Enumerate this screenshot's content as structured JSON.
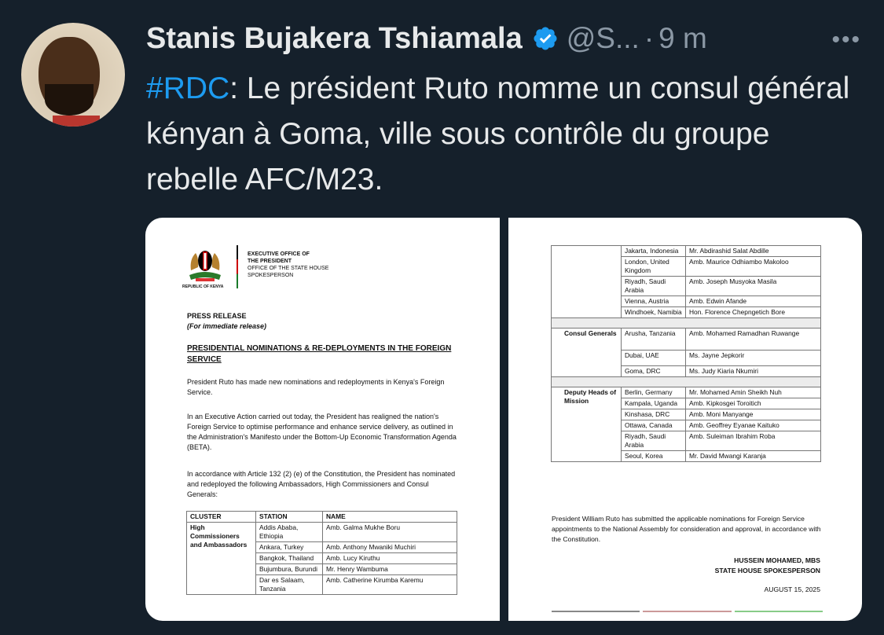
{
  "tweet": {
    "author_name": "Stanis Bujakera Tshiamala",
    "handle": "@S...",
    "separator": "·",
    "time": "9 m",
    "more_label": "•••",
    "hashtag": "#RDC",
    "text": ": Le président Ruto nomme un consul général kényan à Goma, ville sous contrôle du groupe rebelle AFC/M23."
  },
  "colors": {
    "background": "#15202b",
    "link": "#1d9bf0",
    "muted": "#8b98a5",
    "text": "#e7e9ea"
  },
  "icons": {
    "verified": "verified-badge-icon",
    "more": "more-horizontal-icon"
  },
  "document": {
    "page1": {
      "coat_label": "REPUBLIC OF KENYA",
      "office_line1": "EXECUTIVE OFFICE OF",
      "office_line2": "THE PRESIDENT",
      "office_line3": "OFFICE OF THE STATE HOUSE",
      "office_line4": "SPOKESPERSON",
      "press_release": "PRESS RELEASE",
      "release_note": "(For immediate release)",
      "heading": "PRESIDENTIAL NOMINATIONS & RE-DEPLOYMENTS IN THE FOREIGN SERVICE",
      "para1": "President Ruto has made new nominations and redeployments in Kenya's Foreign Service.",
      "para2": "In an Executive Action carried out today, the President has realigned the nation's Foreign Service to optimise performance and enhance service delivery, as outlined in the Administration's Manifesto under the Bottom-Up Economic Transformation Agenda (BETA).",
      "para3": "In accordance with Article 132 (2) (e) of the Constitution, the President has nominated and redeployed the following Ambassadors, High Commissioners and Consul Generals:",
      "table_headers": [
        "CLUSTER",
        "STATION",
        "NAME"
      ],
      "cluster": "High Commissioners and Ambassadors",
      "rows": [
        {
          "station": "Addis Ababa, Ethiopia",
          "name": "Amb. Galma Mukhe Boru"
        },
        {
          "station": "Ankara, Turkey",
          "name": "Amb. Anthony Mwaniki Muchiri"
        },
        {
          "station": "Bangkok, Thailand",
          "name": "Amb. Lucy Kiruthu"
        },
        {
          "station": "Bujumbura, Burundi",
          "name": "Mr. Henry Wambuma"
        },
        {
          "station": "Dar es Salaam, Tanzania",
          "name": "Amb. Catherine Kirumba Karemu"
        }
      ]
    },
    "page2": {
      "rows_top": [
        {
          "station": "Jakarta, Indonesia",
          "name": "Mr. Abdirashid Salat Abdille"
        },
        {
          "station": "London, United Kingdom",
          "name": "Amb. Maurice Odhiambo Makoloo"
        },
        {
          "station": "Riyadh, Saudi Arabia",
          "name": "Amb. Joseph Musyoka Masila"
        },
        {
          "station": "Vienna, Austria",
          "name": "Amb. Edwin Afande"
        },
        {
          "station": "Windhoek, Namibia",
          "name": "Hon. Florence Chepngetich Bore"
        }
      ],
      "consul_cluster": "Consul Generals",
      "consul_rows": [
        {
          "station": "Arusha, Tanzania",
          "name": "Amb. Mohamed Ramadhan Ruwange"
        },
        {
          "station": "Dubai, UAE",
          "name": "Ms. Jayne Jepkorir"
        },
        {
          "station": "Goma, DRC",
          "name": "Ms. Judy Kiaria Nkumiri"
        }
      ],
      "deputy_cluster": "Deputy Heads of Mission",
      "deputy_rows": [
        {
          "station": "Berlin, Germany",
          "name": "Mr. Mohamed Amin Sheikh Nuh"
        },
        {
          "station": "Kampala, Uganda",
          "name": "Amb. Kipkosgei Toroitich"
        },
        {
          "station": "Kinshasa, DRC",
          "name": "Amb. Moni Manyange"
        },
        {
          "station": "Ottawa, Canada",
          "name": "Amb. Geoffrey Eyanae Kaituko"
        },
        {
          "station": "Riyadh, Saudi Arabia",
          "name": "Amb. Suleiman Ibrahim Roba"
        },
        {
          "station": "Seoul, Korea",
          "name": "Mr. David Mwangi Karanja"
        }
      ],
      "closing": "President William Ruto has submitted the applicable nominations for Foreign Service appointments to the National Assembly for consideration and approval, in accordance with the Constitution.",
      "signatory": "HUSSEIN MOHAMED, MBS",
      "signatory_title": "STATE HOUSE SPOKESPERSON",
      "date": "AUGUST 15, 2025"
    }
  }
}
